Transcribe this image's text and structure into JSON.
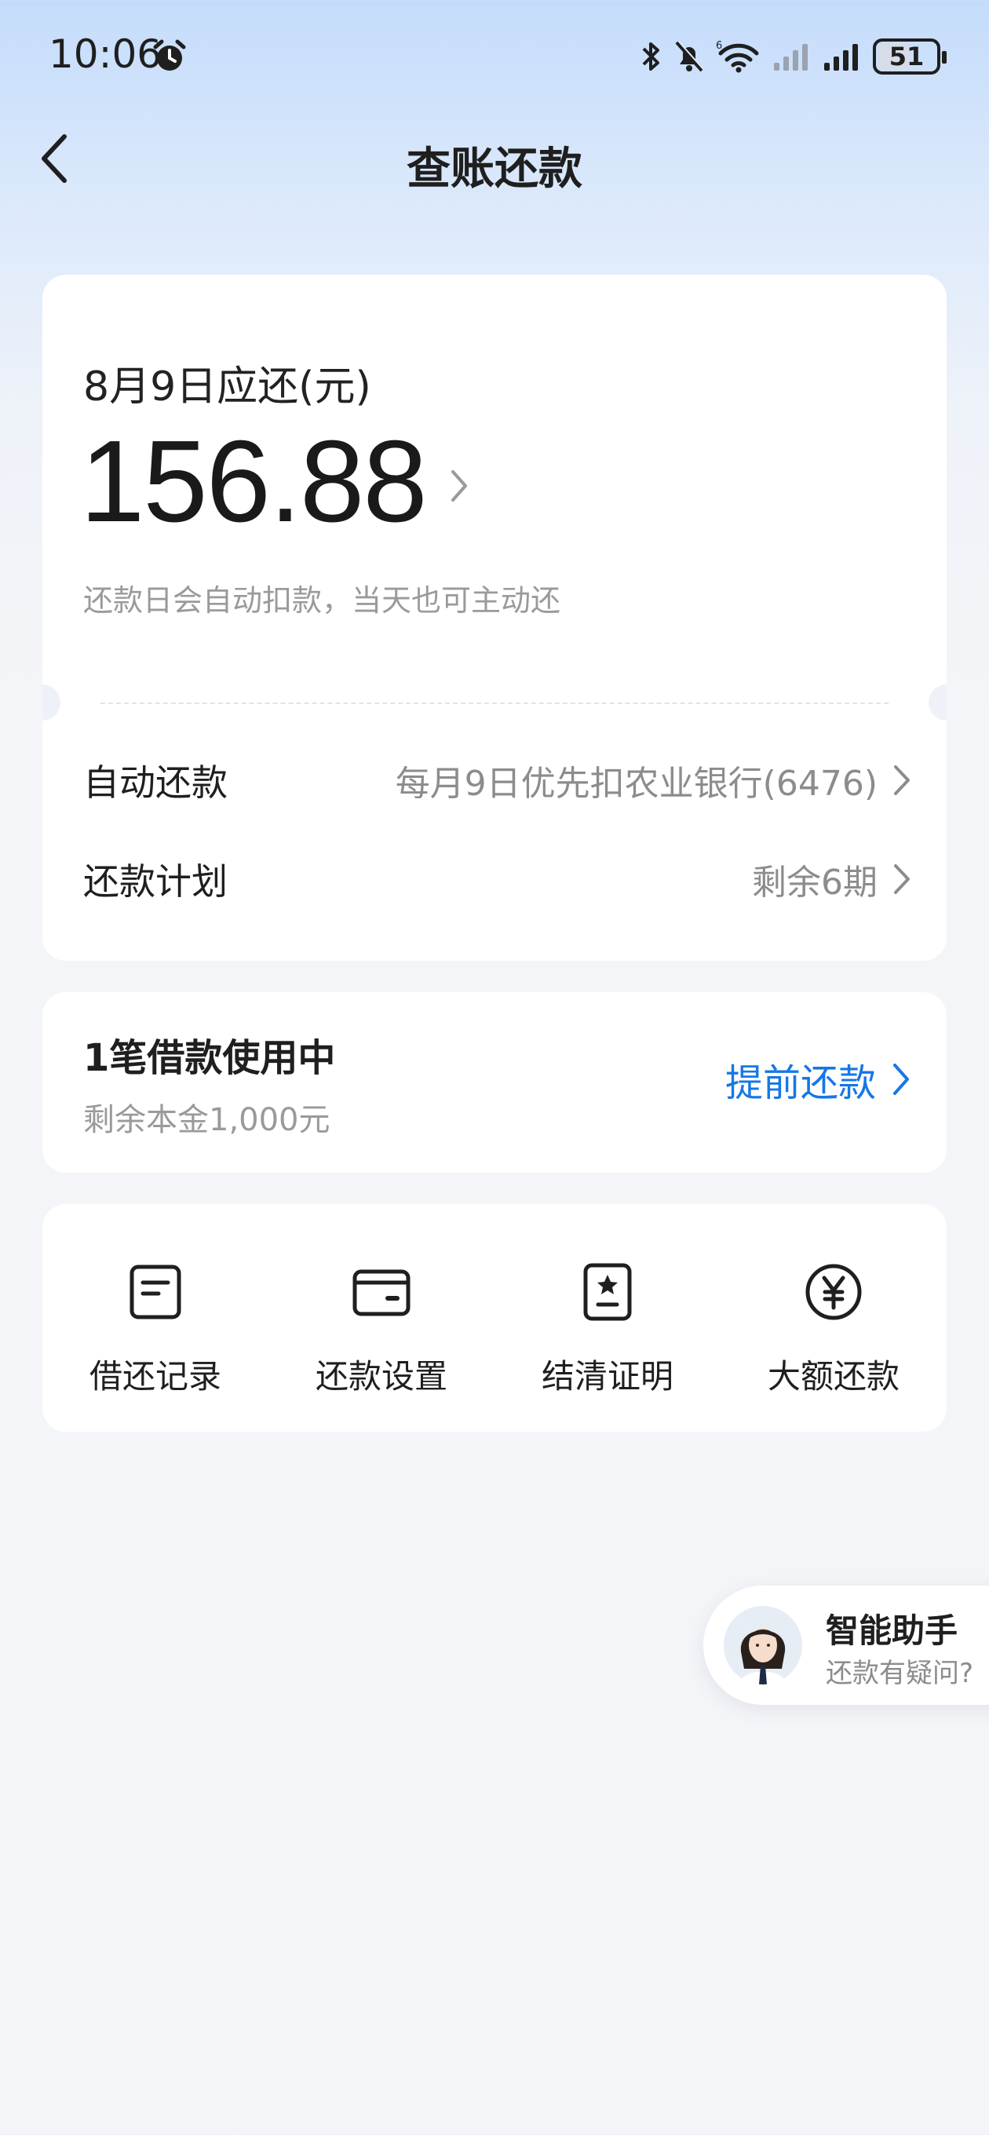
{
  "status_bar": {
    "time": "10:06",
    "battery": "51",
    "icons": [
      "alarm-icon",
      "bluetooth-icon",
      "mute-bell-icon",
      "wifi-6-icon",
      "signal-icon",
      "signal-icon",
      "battery-icon"
    ]
  },
  "nav": {
    "title": "查账还款",
    "back_icon": "chevron-left-icon"
  },
  "due": {
    "label": "8月9日应还(元)",
    "amount": "156.88",
    "hint": "还款日会自动扣款，当天也可主动还"
  },
  "rows": {
    "auto": {
      "label": "自动还款",
      "value": "每月9日优先扣农业银行(6476)"
    },
    "plan": {
      "label": "还款计划",
      "value": "剩余6期"
    }
  },
  "loan": {
    "title": "1笔借款使用中",
    "subtitle": "剩余本金1,000元",
    "action": "提前还款"
  },
  "tools": [
    {
      "label": "借还记录",
      "icon": "record-icon"
    },
    {
      "label": "还款设置",
      "icon": "card-icon"
    },
    {
      "label": "结清证明",
      "icon": "certificate-icon"
    },
    {
      "label": "大额还款",
      "icon": "yuan-icon"
    }
  ],
  "assistant": {
    "name": "智能助手",
    "subtitle": "还款有疑问?"
  },
  "colors": {
    "accent": "#1677e6",
    "text_primary": "#1f1f1f",
    "text_secondary": "#9a9a9a",
    "card_bg": "#ffffff",
    "header_gradient_top": "#c4dcfb"
  }
}
